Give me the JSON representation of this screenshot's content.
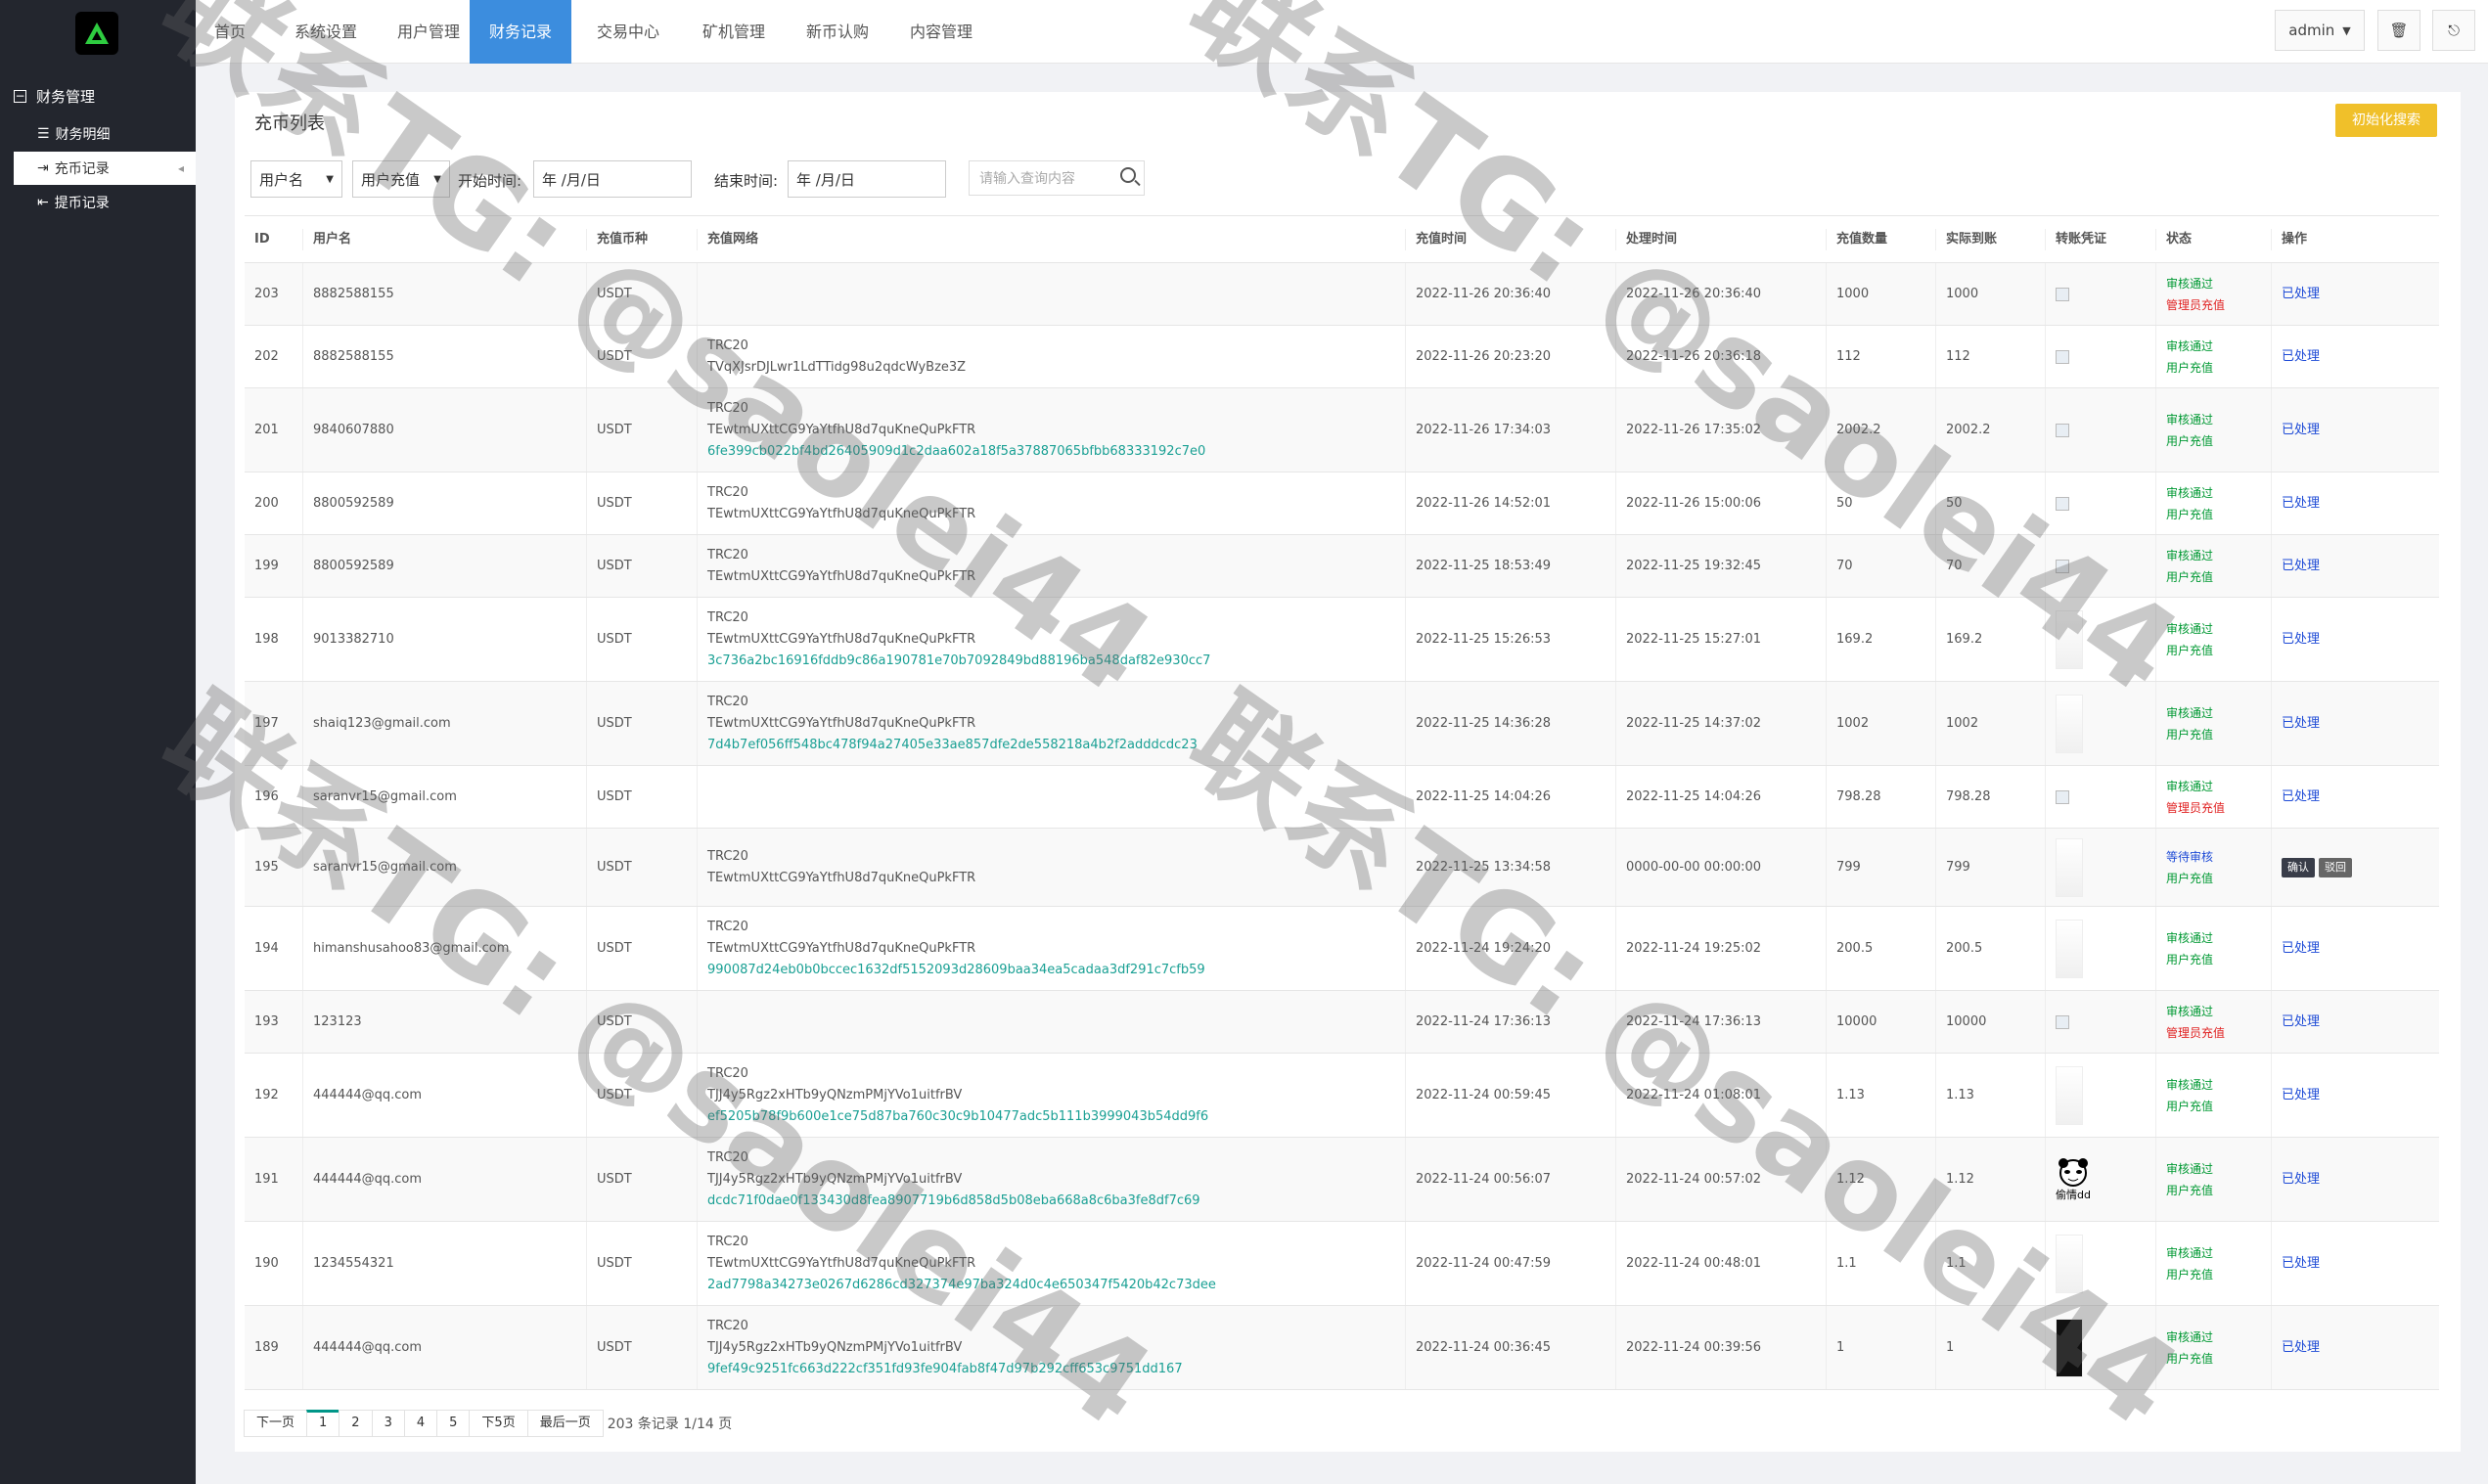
{
  "sidebar": {
    "group": "财务管理",
    "items": [
      {
        "label": "财务明细"
      },
      {
        "label": "充币记录"
      },
      {
        "label": "提币记录"
      }
    ]
  },
  "nav": [
    "首页",
    "系统设置",
    "用户管理",
    "财务记录",
    "交易中心",
    "矿机管理",
    "新币认购",
    "内容管理"
  ],
  "top_right": {
    "user": "admin"
  },
  "panel": {
    "title": "充币列表",
    "init_button": "初始化搜索"
  },
  "filters": {
    "field_select": "用户名",
    "type_select": "用户充值",
    "start_label": "开始时间:",
    "start_value": "年 /月/日",
    "end_label": "结束时间:",
    "end_value": "年 /月/日",
    "search_placeholder": "请输入查询内容"
  },
  "columns": [
    "ID",
    "用户名",
    "充值币种",
    "充值网络",
    "充值时间",
    "处理时间",
    "充值数量",
    "实际到账",
    "转账凭证",
    "状态",
    "操作"
  ],
  "rows": [
    {
      "id": "203",
      "user": "8882588155",
      "coin": "USDT",
      "net": "",
      "addr": "",
      "hash": "",
      "time": "2022-11-26 20:36:40",
      "ptime": "2022-11-26 20:36:40",
      "amt": "1000",
      "real": "1000",
      "voucher": "img",
      "status": "审核通过",
      "sub": "管理员充值",
      "op": "已处理"
    },
    {
      "id": "202",
      "user": "8882588155",
      "coin": "USDT",
      "net": "TRC20",
      "addr": "TVqXJsrDJLwr1LdTTidg98u2qdcWyBze3Z",
      "hash": "",
      "time": "2022-11-26 20:23:20",
      "ptime": "2022-11-26 20:36:18",
      "amt": "112",
      "real": "112",
      "voucher": "img",
      "status": "审核通过",
      "sub": "用户充值",
      "op": "已处理"
    },
    {
      "id": "201",
      "user": "9840607880",
      "coin": "USDT",
      "net": "TRC20",
      "addr": "TEwtmUXttCG9YaYtfhU8d7quKneQuPkFTR",
      "hash": "6fe399cb022bf4bd26405909d1c2daa602a18f5a37887065bfbb68333192c7e0",
      "time": "2022-11-26 17:34:03",
      "ptime": "2022-11-26 17:35:02",
      "amt": "2002.2",
      "real": "2002.2",
      "voucher": "img",
      "status": "审核通过",
      "sub": "用户充值",
      "op": "已处理"
    },
    {
      "id": "200",
      "user": "8800592589",
      "coin": "USDT",
      "net": "TRC20",
      "addr": "TEwtmUXttCG9YaYtfhU8d7quKneQuPkFTR",
      "hash": "",
      "time": "2022-11-26 14:52:01",
      "ptime": "2022-11-26 15:00:06",
      "amt": "50",
      "real": "50",
      "voucher": "img",
      "status": "审核通过",
      "sub": "用户充值",
      "op": "已处理"
    },
    {
      "id": "199",
      "user": "8800592589",
      "coin": "USDT",
      "net": "TRC20",
      "addr": "TEwtmUXttCG9YaYtfhU8d7quKneQuPkFTR",
      "hash": "",
      "time": "2022-11-25 18:53:49",
      "ptime": "2022-11-25 19:32:45",
      "amt": "70",
      "real": "70",
      "voucher": "img",
      "status": "审核通过",
      "sub": "用户充值",
      "op": "已处理"
    },
    {
      "id": "198",
      "user": "9013382710",
      "coin": "USDT",
      "net": "TRC20",
      "addr": "TEwtmUXttCG9YaYtfhU8d7quKneQuPkFTR",
      "hash": "3c736a2bc16916fddb9c86a190781e70b7092849bd88196ba548daf82e930cc7",
      "time": "2022-11-25 15:26:53",
      "ptime": "2022-11-25 15:27:01",
      "amt": "169.2",
      "real": "169.2",
      "voucher": "thumb",
      "status": "审核通过",
      "sub": "用户充值",
      "op": "已处理"
    },
    {
      "id": "197",
      "user": "shaiq123@gmail.com",
      "coin": "USDT",
      "net": "TRC20",
      "addr": "TEwtmUXttCG9YaYtfhU8d7quKneQuPkFTR",
      "hash": "7d4b7ef056ff548bc478f94a27405e33ae857dfe2de558218a4b2f2adddcdc23",
      "time": "2022-11-25 14:36:28",
      "ptime": "2022-11-25 14:37:02",
      "amt": "1002",
      "real": "1002",
      "voucher": "thumb",
      "status": "审核通过",
      "sub": "用户充值",
      "op": "已处理"
    },
    {
      "id": "196",
      "user": "saranvr15@gmail.com",
      "coin": "USDT",
      "net": "",
      "addr": "",
      "hash": "",
      "time": "2022-11-25 14:04:26",
      "ptime": "2022-11-25 14:04:26",
      "amt": "798.28",
      "real": "798.28",
      "voucher": "img",
      "status": "审核通过",
      "sub": "管理员充值",
      "op": "已处理"
    },
    {
      "id": "195",
      "user": "saranvr15@gmail.com",
      "coin": "USDT",
      "net": "TRC20",
      "addr": "TEwtmUXttCG9YaYtfhU8d7quKneQuPkFTR",
      "hash": "",
      "time": "2022-11-25 13:34:58",
      "ptime": "0000-00-00 00:00:00",
      "amt": "799",
      "real": "799",
      "voucher": "thumb",
      "status": "等待审核",
      "sub": "用户充值",
      "op": "",
      "btn1": "确认",
      "btn2": "驳回"
    },
    {
      "id": "194",
      "user": "himanshusahoo83@gmail.com",
      "coin": "USDT",
      "net": "TRC20",
      "addr": "TEwtmUXttCG9YaYtfhU8d7quKneQuPkFTR",
      "hash": "990087d24eb0b0bccec1632df5152093d28609baa34ea5cadaa3df291c7cfb59",
      "time": "2022-11-24 19:24:20",
      "ptime": "2022-11-24 19:25:02",
      "amt": "200.5",
      "real": "200.5",
      "voucher": "thumb",
      "status": "审核通过",
      "sub": "用户充值",
      "op": "已处理"
    },
    {
      "id": "193",
      "user": "123123",
      "coin": "USDT",
      "net": "",
      "addr": "",
      "hash": "",
      "time": "2022-11-24 17:36:13",
      "ptime": "2022-11-24 17:36:13",
      "amt": "10000",
      "real": "10000",
      "voucher": "img",
      "status": "审核通过",
      "sub": "管理员充值",
      "op": "已处理"
    },
    {
      "id": "192",
      "user": "444444@qq.com",
      "coin": "USDT",
      "net": "TRC20",
      "addr": "TJJ4y5Rgz2xHTb9yQNzmPMjYVo1uitfrBV",
      "hash": "ef5205b78f9b600e1ce75d87ba760c30c9b10477adc5b111b3999043b54dd9f6",
      "time": "2022-11-24 00:59:45",
      "ptime": "2022-11-24 01:08:01",
      "amt": "1.13",
      "real": "1.13",
      "voucher": "thumb",
      "status": "审核通过",
      "sub": "用户充值",
      "op": "已处理"
    },
    {
      "id": "191",
      "user": "444444@qq.com",
      "coin": "USDT",
      "net": "TRC20",
      "addr": "TJJ4y5Rgz2xHTb9yQNzmPMjYVo1uitfrBV",
      "hash": "dcdc71f0dae0f133430d8fea8907719b6d858d5b08eba668a8c6ba3fe8df7c69",
      "time": "2022-11-24 00:56:07",
      "ptime": "2022-11-24 00:57:02",
      "amt": "1.12",
      "real": "1.12",
      "voucher": "meme",
      "meme_text": "偷情dd",
      "status": "审核通过",
      "sub": "用户充值",
      "op": "已处理"
    },
    {
      "id": "190",
      "user": "1234554321",
      "coin": "USDT",
      "net": "TRC20",
      "addr": "TEwtmUXttCG9YaYtfhU8d7quKneQuPkFTR",
      "hash": "2ad7798a34273e0267d6286cd327374e97ba324d0c4e650347f5420b42c73dee",
      "time": "2022-11-24 00:47:59",
      "ptime": "2022-11-24 00:48:01",
      "amt": "1.1",
      "real": "1.1",
      "voucher": "thumb",
      "status": "审核通过",
      "sub": "用户充值",
      "op": "已处理"
    },
    {
      "id": "189",
      "user": "444444@qq.com",
      "coin": "USDT",
      "net": "TRC20",
      "addr": "TJJ4y5Rgz2xHTb9yQNzmPMjYVo1uitfrBV",
      "hash": "9fef49c9251fc663d222cf351fd93fe904fab8f47d97b292cff653c9751dd167",
      "time": "2022-11-24 00:36:45",
      "ptime": "2022-11-24 00:39:56",
      "amt": "1",
      "real": "1",
      "voucher": "dark",
      "status": "审核通过",
      "sub": "用户充值",
      "op": "已处理"
    }
  ],
  "pager": {
    "prev": "下一页",
    "pages": [
      "1",
      "2",
      "3",
      "4",
      "5"
    ],
    "next5": "下5页",
    "last": "最后一页",
    "info": "203 条记录 1/14 页"
  },
  "watermark": "联系TG: @saolei44",
  "colors": {
    "sidebar": "#23262e",
    "nav_active": "#3c8dde",
    "init_button": "#f0c02a",
    "hash": "#1aa094",
    "status_ok": "#009933",
    "status_admin": "#e02020",
    "link": "#1e4bd6"
  }
}
